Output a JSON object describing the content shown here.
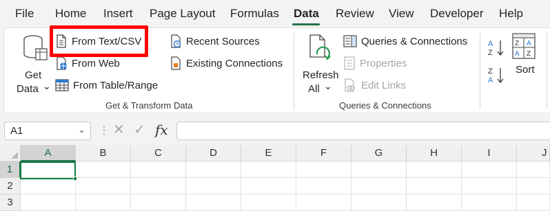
{
  "menu": {
    "items": [
      "File",
      "Home",
      "Insert",
      "Page Layout",
      "Formulas",
      "Data",
      "Review",
      "View",
      "Developer",
      "Help"
    ],
    "active": "Data"
  },
  "ribbon": {
    "get_data": {
      "line1": "Get",
      "line2": "Data",
      "chevron": "⌄"
    },
    "from_text_csv": "From Text/CSV",
    "from_web": "From Web",
    "from_table_range": "From Table/Range",
    "recent_sources": "Recent Sources",
    "existing_connections": "Existing Connections",
    "group_get_transform": "Get & Transform Data",
    "refresh_all": {
      "line1": "Refresh",
      "line2": "All",
      "chevron": "⌄"
    },
    "queries_connections": "Queries & Connections",
    "properties": "Properties",
    "edit_links": "Edit Links",
    "group_queries": "Queries & Connections",
    "sort": "Sort"
  },
  "formula_bar": {
    "name_box": "A1",
    "dots": "⋮",
    "cancel_glyph": "✕",
    "enter_glyph": "✓",
    "fx": "fx",
    "value": ""
  },
  "sheet": {
    "columns": [
      "A",
      "B",
      "C",
      "D",
      "E",
      "F",
      "G",
      "H",
      "I",
      "J"
    ],
    "rows": [
      "1",
      "2",
      "3"
    ],
    "active_cell": "A1"
  },
  "colors": {
    "accent": "#217346",
    "highlight": "#ff0000"
  }
}
